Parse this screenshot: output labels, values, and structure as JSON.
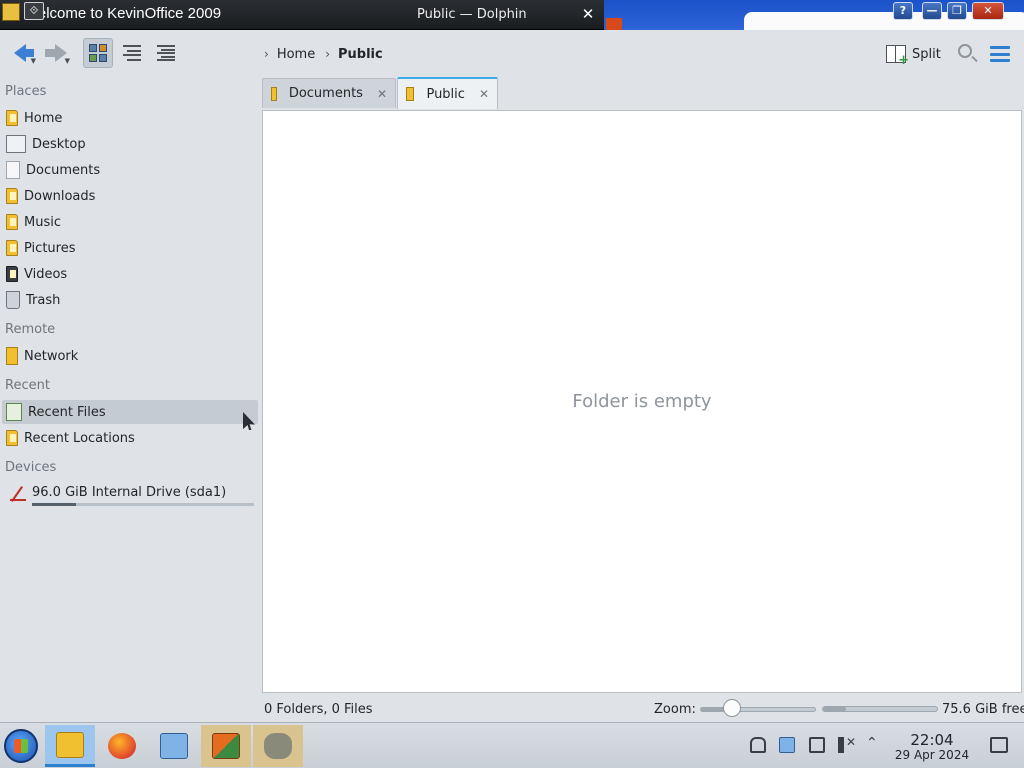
{
  "top": {
    "background_window_title": "Welcome to KevinOffice 2009",
    "window_title": "Public — Dolphin",
    "close_glyph": "✕",
    "help_glyph": "?",
    "minimize_glyph": "—",
    "restore_glyph": "❐",
    "close_glyph_2": "✕",
    "system_glyph": "⟐"
  },
  "toolbar": {
    "breadcrumb": [
      {
        "label": "Home"
      },
      {
        "label": "Public"
      }
    ],
    "split_label": "Split",
    "icons": {
      "back": "back-arrow-icon",
      "forward": "forward-arrow-icon",
      "icons_view": "icons-view-icon",
      "compact_view": "compact-view-icon",
      "details_view": "details-view-icon",
      "search": "search-icon",
      "menu": "hamburger-menu-icon"
    },
    "chevron": "›"
  },
  "sidebar": {
    "sections": {
      "places": "Places",
      "remote": "Remote",
      "recent": "Recent",
      "devices": "Devices"
    },
    "places": [
      {
        "label": "Home",
        "icon": "home-folder-icon"
      },
      {
        "label": "Desktop",
        "icon": "desktop-icon"
      },
      {
        "label": "Documents",
        "icon": "documents-icon"
      },
      {
        "label": "Downloads",
        "icon": "downloads-folder-icon"
      },
      {
        "label": "Music",
        "icon": "music-folder-icon"
      },
      {
        "label": "Pictures",
        "icon": "pictures-folder-icon"
      },
      {
        "label": "Videos",
        "icon": "videos-folder-icon"
      },
      {
        "label": "Trash",
        "icon": "trash-icon"
      }
    ],
    "remote": [
      {
        "label": "Network",
        "icon": "network-icon"
      }
    ],
    "recent": [
      {
        "label": "Recent Files",
        "icon": "recent-files-icon"
      },
      {
        "label": "Recent Locations",
        "icon": "recent-locations-icon"
      }
    ],
    "devices": [
      {
        "label": "96.0 GiB Internal Drive (sda1)",
        "icon": "drive-icon",
        "used_fraction": 0.2
      }
    ]
  },
  "tabs": [
    {
      "label": "Documents",
      "close": "✕"
    },
    {
      "label": "Public",
      "close": "✕"
    }
  ],
  "view": {
    "empty_message": "Folder is empty"
  },
  "status": {
    "summary": "0 Folders, 0 Files",
    "zoom_label": "Zoom:",
    "zoom_fraction": 0.28,
    "free_label": "75.6 GiB free",
    "used_fraction": 0.2
  },
  "taskbar": {
    "apps": [
      {
        "name": "start-menu",
        "icon": "start-orb-icon"
      },
      {
        "name": "file-manager",
        "icon": "folder-icon"
      },
      {
        "name": "firefox",
        "icon": "firefox-icon"
      },
      {
        "name": "system-settings",
        "icon": "system-settings-icon"
      },
      {
        "name": "kevinoffice",
        "icon": "office-icon"
      },
      {
        "name": "gimp",
        "icon": "gimp-icon"
      }
    ],
    "tray_caret": "⌃",
    "clock_time": "22:04",
    "clock_date": "29 Apr 2024"
  }
}
